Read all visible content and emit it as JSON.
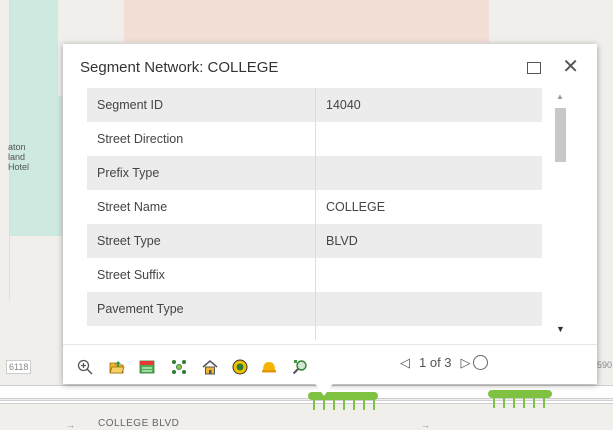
{
  "map": {
    "labels": {
      "hotel": [
        "aton",
        "land",
        "Hotel"
      ],
      "left_number": "6118",
      "right_number": "590"
    },
    "street_name": "COLLEGE BLVD"
  },
  "popup": {
    "title": "Segment Network: COLLEGE",
    "rows": [
      {
        "label": "Segment ID",
        "value": "14040"
      },
      {
        "label": "Street Direction",
        "value": ""
      },
      {
        "label": "Prefix Type",
        "value": ""
      },
      {
        "label": "Street Name",
        "value": "COLLEGE"
      },
      {
        "label": "Street Type",
        "value": "BLVD"
      },
      {
        "label": "Street Suffix",
        "value": ""
      },
      {
        "label": "Pavement Type",
        "value": ""
      },
      {
        "label": "",
        "value": ""
      }
    ],
    "pager": {
      "text": "1 of 3"
    }
  },
  "colors": {
    "popup_bg": "#ffffff",
    "row_alt": "#ececec",
    "teal_block": "#cbe8df",
    "pink_block": "#f3ddd6",
    "tree_green": "#7fc241"
  }
}
